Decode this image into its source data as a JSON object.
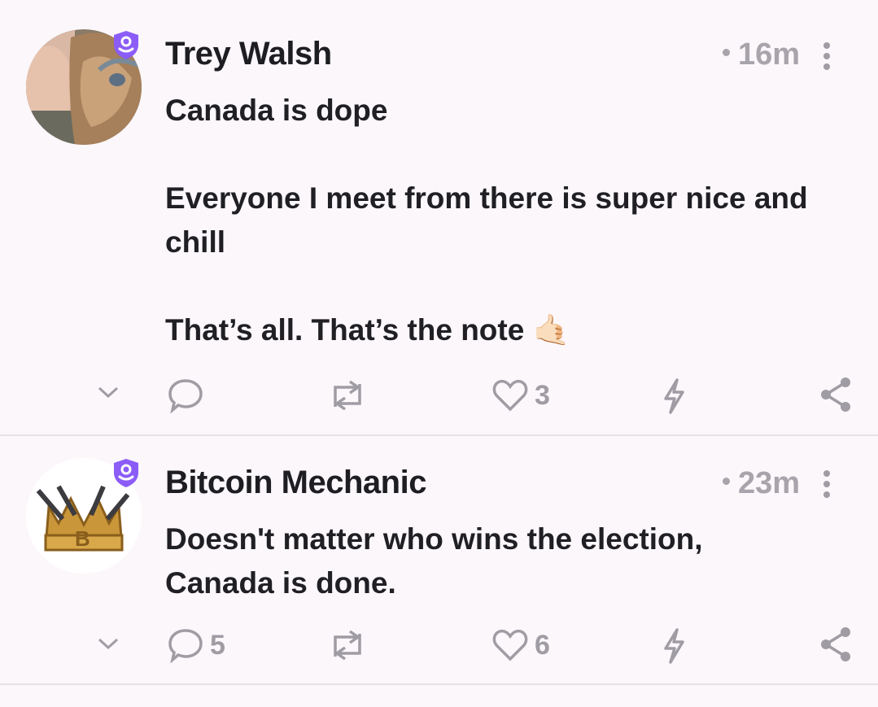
{
  "posts": [
    {
      "author": "Trey Walsh",
      "time": "16m",
      "content": [
        "Canada is dope",
        "",
        "Everyone I meet from there is super nice and chill",
        "",
        "That’s all. That’s the note 🤙🏻"
      ],
      "actions": {
        "replies": "",
        "reposts": "",
        "likes": "3",
        "zaps": ""
      },
      "avatar_icon": "user-avatar-photo",
      "badge_icon": "verified-shield-icon"
    },
    {
      "author": "Bitcoin Mechanic",
      "time": "23m",
      "content": [
        "Doesn't matter who wins the election,",
        "Canada is done."
      ],
      "actions": {
        "replies": "5",
        "reposts": "",
        "likes": "6",
        "zaps": ""
      },
      "avatar_icon": "crown-tools-avatar",
      "badge_icon": "verified-shield-icon"
    }
  ],
  "colors": {
    "accent": "#8b5cf6",
    "muted": "#9f9ca4",
    "background": "#fbf7fb"
  }
}
